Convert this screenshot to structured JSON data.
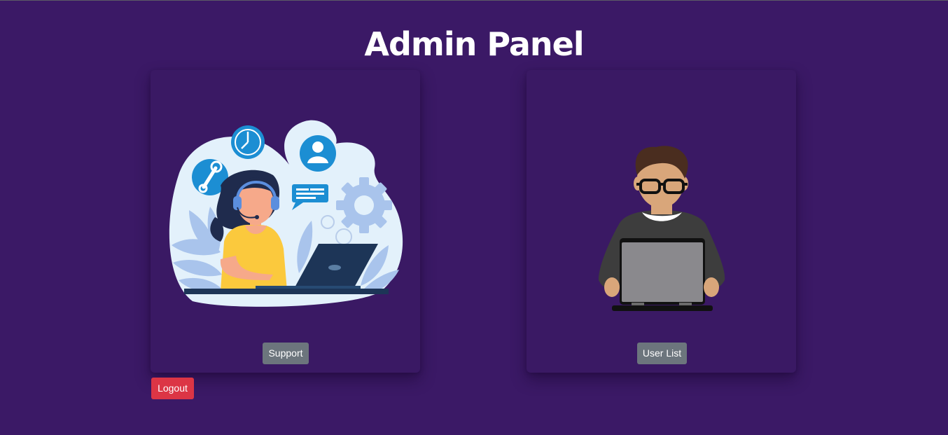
{
  "header": {
    "title": "Admin Panel"
  },
  "cards": [
    {
      "illustration": "customer-support-agent-illustration",
      "button_label": "Support"
    },
    {
      "illustration": "man-with-laptop-illustration",
      "button_label": "User List"
    }
  ],
  "actions": {
    "logout_label": "Logout"
  },
  "colors": {
    "background": "#3b1966",
    "card": "#3a1964",
    "secondary_button": "#6c757d",
    "danger_button": "#dc3545",
    "title": "#ffffff"
  }
}
